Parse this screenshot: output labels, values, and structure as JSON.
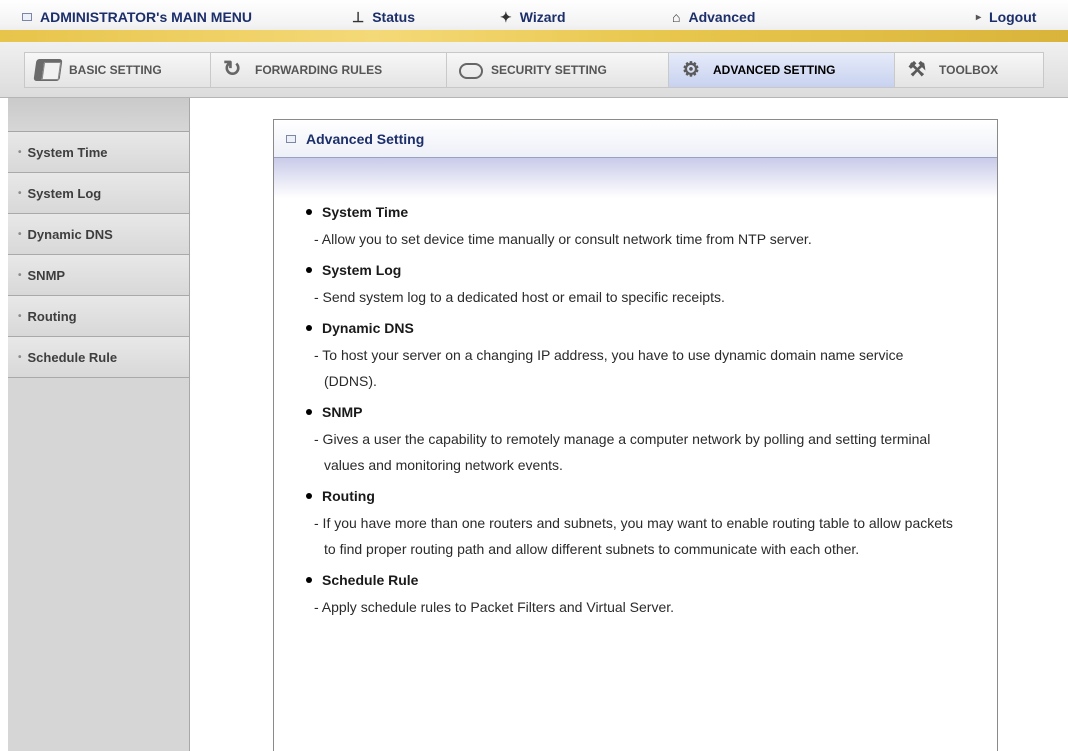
{
  "topbar": {
    "main_menu": "ADMINISTRATOR's MAIN MENU",
    "status": "Status",
    "wizard": "Wizard",
    "advanced": "Advanced",
    "logout": "Logout"
  },
  "tabs": [
    {
      "label": "BASIC SETTING",
      "icon": "book-icon"
    },
    {
      "label": "FORWARDING RULES",
      "icon": "arrow-icon"
    },
    {
      "label": "SECURITY SETTING",
      "icon": "lock-icon"
    },
    {
      "label": "ADVANCED SETTING",
      "icon": "advanced-icon",
      "active": true
    },
    {
      "label": "TOOLBOX",
      "icon": "toolbox-icon"
    }
  ],
  "sidebar": {
    "items": [
      {
        "label": "System Time"
      },
      {
        "label": "System Log"
      },
      {
        "label": "Dynamic DNS"
      },
      {
        "label": "SNMP"
      },
      {
        "label": "Routing"
      },
      {
        "label": "Schedule Rule"
      }
    ]
  },
  "panel": {
    "title": "Advanced Setting",
    "entries": [
      {
        "title": "System Time",
        "desc": "- Allow you to set device time manually or consult network time from NTP server."
      },
      {
        "title": "System Log",
        "desc": "- Send system log to a dedicated host or email to specific receipts."
      },
      {
        "title": "Dynamic DNS",
        "desc": "- To host your server on a changing IP address, you have to use dynamic domain name service (DDNS)."
      },
      {
        "title": "SNMP",
        "desc": "- Gives a user the capability to remotely manage a computer network by polling and setting terminal values and monitoring network events."
      },
      {
        "title": "Routing",
        "desc": "- If you have more than one routers and subnets, you may want to enable routing table to allow packets to find proper routing path and allow different subnets to communicate with each other."
      },
      {
        "title": "Schedule Rule",
        "desc": "- Apply schedule rules to Packet Filters and Virtual Server."
      }
    ]
  }
}
